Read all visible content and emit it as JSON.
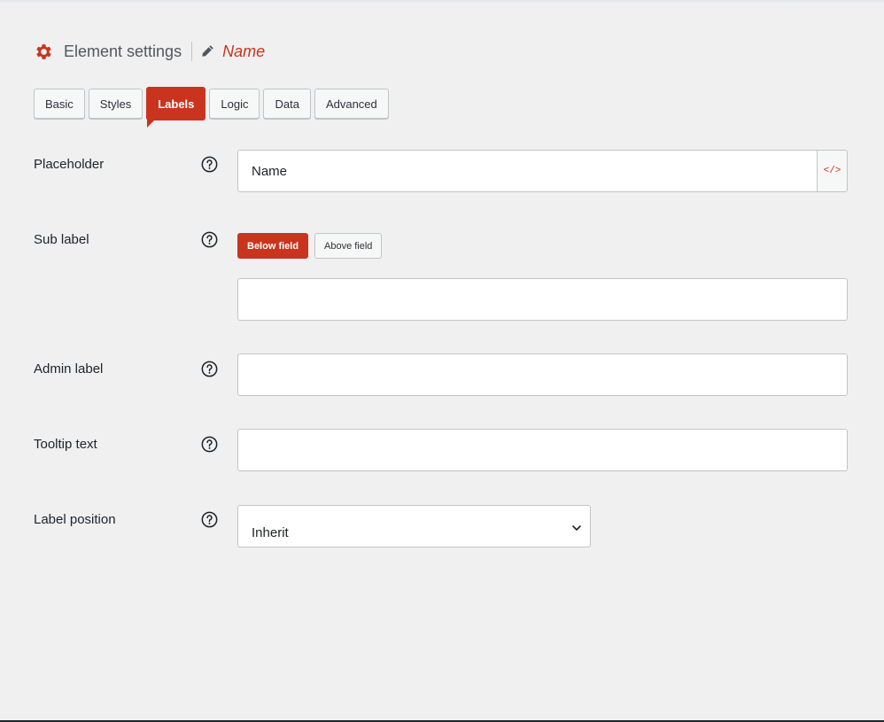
{
  "header": {
    "icon": "gear-icon",
    "title": "Element settings",
    "edit_icon": "pencil-icon",
    "element_name": "Name"
  },
  "tabs": [
    {
      "label": "Basic",
      "active": false
    },
    {
      "label": "Styles",
      "active": false
    },
    {
      "label": "Labels",
      "active": true
    },
    {
      "label": "Logic",
      "active": false
    },
    {
      "label": "Data",
      "active": false
    },
    {
      "label": "Advanced",
      "active": false
    }
  ],
  "fields": {
    "placeholder": {
      "label": "Placeholder",
      "value": "Name",
      "button": "</>"
    },
    "sub_label": {
      "label": "Sub label",
      "options": [
        "Below field",
        "Above field"
      ],
      "selected": "Below field",
      "value": ""
    },
    "admin_label": {
      "label": "Admin label",
      "value": ""
    },
    "tooltip_text": {
      "label": "Tooltip text",
      "value": ""
    },
    "label_position": {
      "label": "Label position",
      "value": "Inherit"
    }
  },
  "colors": {
    "accent": "#c9341e",
    "background": "#f0f0f1",
    "border": "#c3c4c7"
  }
}
